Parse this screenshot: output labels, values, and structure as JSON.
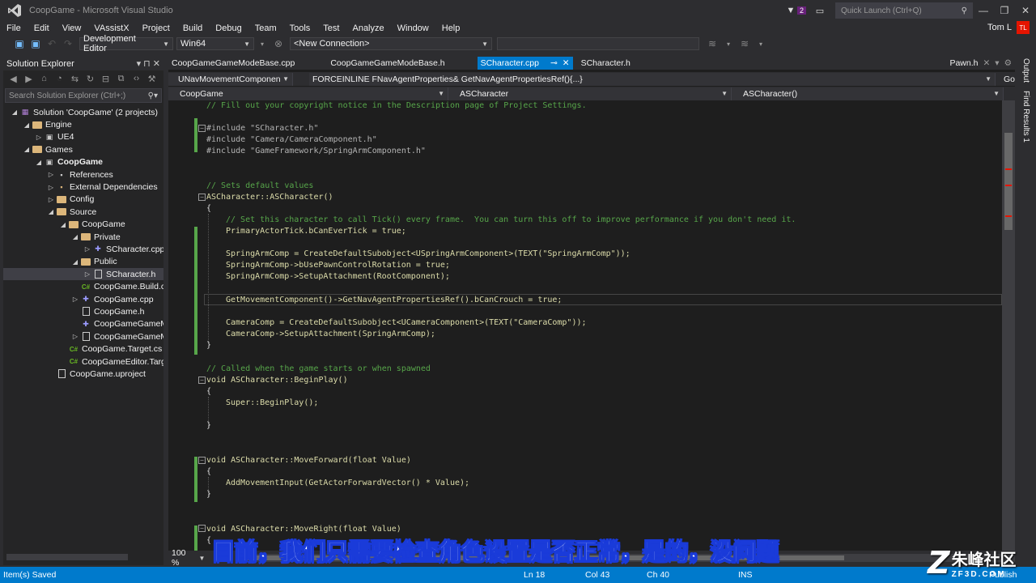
{
  "window": {
    "title": "CoopGame - Microsoft Visual Studio",
    "notification_count": "2",
    "quick_launch_placeholder": "Quick Launch (Ctrl+Q)"
  },
  "menu": [
    "File",
    "Edit",
    "View",
    "VAssistX",
    "Project",
    "Build",
    "Debug",
    "Team",
    "Tools",
    "Test",
    "Analyze",
    "Window",
    "Help"
  ],
  "user": {
    "name": "Tom L",
    "initials": "TL"
  },
  "toolbar": {
    "configuration": "Development Editor",
    "platform": "Win64",
    "connection": "<New Connection>"
  },
  "solution_explorer": {
    "title": "Solution Explorer",
    "search_placeholder": "Search Solution Explorer (Ctrl+;)",
    "items": [
      {
        "label": "Solution 'CoopGame' (2 projects)",
        "depth": 0,
        "twisty": "◢",
        "icon": "solution-icon"
      },
      {
        "label": "Engine",
        "depth": 1,
        "twisty": "◢",
        "icon": "folder-icon"
      },
      {
        "label": "UE4",
        "depth": 2,
        "twisty": "▷",
        "icon": "project-icon"
      },
      {
        "label": "Games",
        "depth": 1,
        "twisty": "◢",
        "icon": "folder-icon"
      },
      {
        "label": "CoopGame",
        "depth": 2,
        "twisty": "◢",
        "icon": "project-icon",
        "bold": true
      },
      {
        "label": "References",
        "depth": 3,
        "twisty": "▷",
        "icon": "references-icon"
      },
      {
        "label": "External Dependencies",
        "depth": 3,
        "twisty": "▷",
        "icon": "dependencies-icon"
      },
      {
        "label": "Config",
        "depth": 3,
        "twisty": "▷",
        "icon": "folder-icon"
      },
      {
        "label": "Source",
        "depth": 3,
        "twisty": "◢",
        "icon": "folder-icon"
      },
      {
        "label": "CoopGame",
        "depth": 4,
        "twisty": "◢",
        "icon": "folder-icon"
      },
      {
        "label": "Private",
        "depth": 5,
        "twisty": "◢",
        "icon": "folder-icon"
      },
      {
        "label": "SCharacter.cpp",
        "depth": 6,
        "twisty": "▷",
        "icon": "cpp-file-icon"
      },
      {
        "label": "Public",
        "depth": 5,
        "twisty": "◢",
        "icon": "folder-icon"
      },
      {
        "label": "SCharacter.h",
        "depth": 6,
        "twisty": "▷",
        "icon": "header-file-icon",
        "selected": true
      },
      {
        "label": "CoopGame.Build.cs",
        "depth": 5,
        "twisty": "",
        "icon": "cs-file-icon"
      },
      {
        "label": "CoopGame.cpp",
        "depth": 5,
        "twisty": "▷",
        "icon": "cpp-file-icon"
      },
      {
        "label": "CoopGame.h",
        "depth": 5,
        "twisty": "",
        "icon": "header-file-icon"
      },
      {
        "label": "CoopGameGameMod",
        "depth": 5,
        "twisty": "",
        "icon": "cpp-file-icon"
      },
      {
        "label": "CoopGameGameMod",
        "depth": 5,
        "twisty": "▷",
        "icon": "header-file-icon"
      },
      {
        "label": "CoopGame.Target.cs",
        "depth": 4,
        "twisty": "",
        "icon": "cs-file-icon"
      },
      {
        "label": "CoopGameEditor.Target.",
        "depth": 4,
        "twisty": "",
        "icon": "cs-file-icon"
      },
      {
        "label": "CoopGame.uproject",
        "depth": 3,
        "twisty": "",
        "icon": "uproject-file-icon"
      }
    ]
  },
  "editor": {
    "tabs": [
      {
        "label": "CoopGameGameModeBase.cpp",
        "active": false
      },
      {
        "label": "CoopGameGameModeBase.h",
        "active": false
      },
      {
        "label": "SCharacter.cpp",
        "active": true
      },
      {
        "label": "SCharacter.h",
        "active": false
      }
    ],
    "tab_right": "Pawn.h",
    "nav_scope": "UNavMovementComponen",
    "nav_member": "FORCEINLINE FNavAgentProperties& GetNavAgentPropertiesRef(){...}",
    "nav_go": "Go",
    "nav_project": "CoopGame",
    "nav_class": "ASCharacter",
    "nav_function": "ASCharacter()",
    "zoom": "100 %"
  },
  "code_lines": [
    "// Fill out your copyright notice in the Description page of Project Settings.",
    "#include \"SCharacter.h\"",
    "#include \"Camera/CameraComponent.h\"",
    "#include \"GameFramework/SpringArmComponent.h\"",
    "// Sets default values",
    "ASCharacter::ASCharacter()",
    "{",
    "// Set this character to call Tick() every frame.  You can turn this off to improve performance if you don't need it.",
    "PrimaryActorTick.bCanEverTick = true;",
    "SpringArmComp = CreateDefaultSubobject<USpringArmComponent>(TEXT(\"SpringArmComp\"));",
    "SpringArmComp->bUsePawnControlRotation = true;",
    "SpringArmComp->SetupAttachment(RootComponent);",
    "GetMovementComponent()->GetNavAgentPropertiesRef().bCanCrouch = true;",
    "CameraComp = CreateDefaultSubobject<UCameraComponent>(TEXT(\"CameraComp\"));",
    "CameraComp->SetupAttachment(SpringArmComp);",
    "}",
    "// Called when the game starts or when spawned",
    "void ASCharacter::BeginPlay()",
    "{",
    "Super::BeginPlay();",
    "}",
    "void ASCharacter::MoveForward(float Value)",
    "{",
    "AddMovementInput(GetActorForwardVector() * Value);",
    "}",
    "void ASCharacter::MoveRight(float Value)",
    "{"
  ],
  "right_dock": [
    "Output",
    "Find Results 1"
  ],
  "status": {
    "message": "Item(s) Saved",
    "line": "Ln 18",
    "col": "Col 43",
    "ch": "Ch 40",
    "mode": "INS",
    "publish": "Publish"
  },
  "subtitle": "目前，我们只需要检查角色设置是否正常，是的，没问题",
  "watermark": {
    "cn": "朱峰社区",
    "en": "ZF3D.COM"
  },
  "colors": {
    "accent": "#007acc",
    "background": "#2d2d30",
    "editor_bg": "#1e1e1e",
    "comment": "#57a64a",
    "keyword": "#569cd6",
    "string": "#d69d85",
    "type": "#4ec9b0"
  }
}
